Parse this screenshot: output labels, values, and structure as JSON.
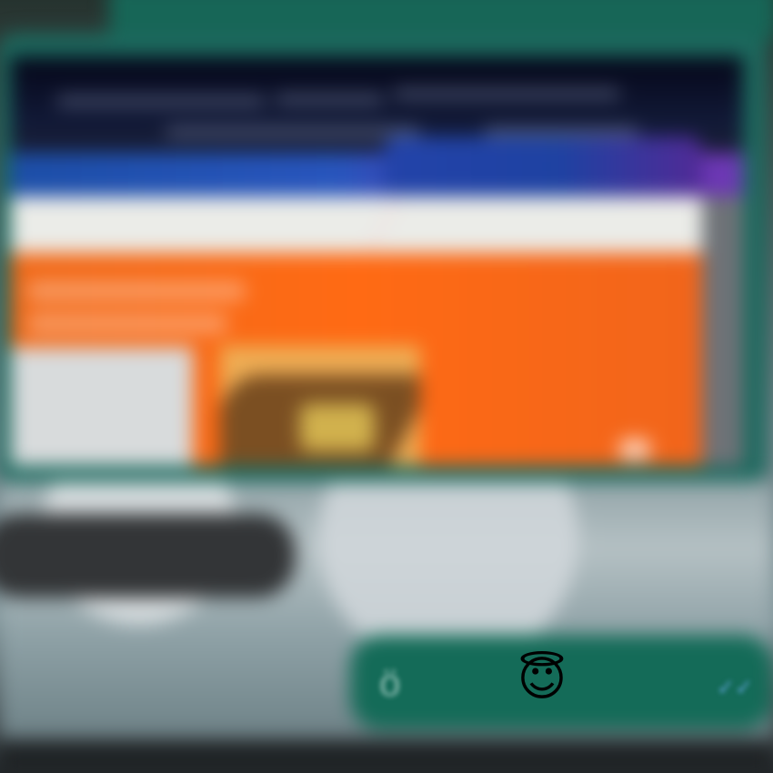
{
  "chat": {
    "left_message": {
      "text": "",
      "timestamp": ""
    },
    "right_message": {
      "text": "ö",
      "emoji": "😇",
      "timestamp": "",
      "status_icon": "read-ticks"
    }
  },
  "shared_media": {
    "kind": "screenshot-image"
  },
  "colors": {
    "chat_bubble_green": "#146b58",
    "media_orange": "#ff6a14",
    "media_blue": "#2855bd",
    "media_purple": "#6e39b6",
    "gray_bubble": "#333537"
  }
}
